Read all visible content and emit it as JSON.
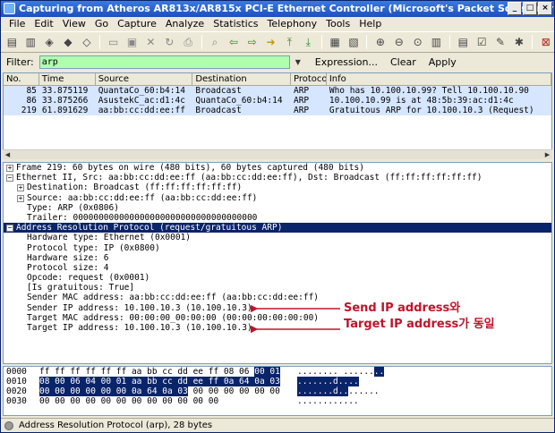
{
  "window": {
    "title": "Capturing from Atheros AR813x/AR815x PCI-E Ethernet Controller (Microsoft's Packet Scheduler)  -  Wireshark"
  },
  "menu": [
    "File",
    "Edit",
    "View",
    "Go",
    "Capture",
    "Analyze",
    "Statistics",
    "Telephony",
    "Tools",
    "Help"
  ],
  "filter": {
    "label": "Filter:",
    "value": "arp",
    "expression_label": "Expression...",
    "clear_label": "Clear",
    "apply_label": "Apply"
  },
  "packet_list": {
    "columns": [
      "No.",
      "Time",
      "Source",
      "Destination",
      "Protocol",
      "Info"
    ],
    "rows": [
      {
        "no": "85",
        "time": "33.875119",
        "source": "QuantaCo_60:b4:14",
        "destination": "Broadcast",
        "protocol": "ARP",
        "info": "Who has 10.100.10.99?  Tell 10.100.10.90"
      },
      {
        "no": "86",
        "time": "33.875266",
        "source": "AsustekC_ac:d1:4c",
        "destination": "QuantaCo_60:b4:14",
        "protocol": "ARP",
        "info": "10.100.10.99 is at 48:5b:39:ac:d1:4c"
      },
      {
        "no": "219",
        "time": "61.891629",
        "source": "aa:bb:cc:dd:ee:ff",
        "destination": "Broadcast",
        "protocol": "ARP",
        "info": "Gratuitous ARP for 10.100.10.3 (Request)"
      }
    ]
  },
  "details": {
    "frame": "Frame 219: 60 bytes on wire (480 bits), 60 bytes captured (480 bits)",
    "ethernet": "Ethernet II, Src: aa:bb:cc:dd:ee:ff (aa:bb:cc:dd:ee:ff), Dst: Broadcast (ff:ff:ff:ff:ff:ff)",
    "eth_dst": "Destination: Broadcast (ff:ff:ff:ff:ff:ff)",
    "eth_src": "Source: aa:bb:cc:dd:ee:ff (aa:bb:cc:dd:ee:ff)",
    "eth_type": "Type: ARP (0x0806)",
    "eth_trailer": "Trailer: 000000000000000000000000000000000000",
    "arp": "Address Resolution Protocol (request/gratuitous ARP)",
    "arp_hw_type": "Hardware type: Ethernet (0x0001)",
    "arp_proto_type": "Protocol type: IP (0x0800)",
    "arp_hw_size": "Hardware size: 6",
    "arp_proto_size": "Protocol size: 4",
    "arp_opcode": "Opcode: request (0x0001)",
    "arp_gratuitous": "[Is gratuitous: True]",
    "arp_sender_mac": "Sender MAC address: aa:bb:cc:dd:ee:ff (aa:bb:cc:dd:ee:ff)",
    "arp_sender_ip": "Sender IP address: 10.100.10.3 (10.100.10.3)",
    "arp_target_mac": "Target MAC address: 00:00:00_00:00:00 (00:00:00:00:00:00)",
    "arp_target_ip": "Target IP address: 10.100.10.3 (10.100.10.3)"
  },
  "annotation": {
    "line1": "Send IP address와",
    "line2": "Target IP address가 동일",
    "color": "#c0132a"
  },
  "bytes": [
    {
      "offset": "0000",
      "hex_a": "ff ff ff ff ff ff aa bb  cc dd ee ff 08 06 ",
      "hex_b": "00 01",
      "ascii_a": "........ ......",
      "ascii_b": ".."
    },
    {
      "offset": "0010",
      "hex_a": "",
      "hex_b": "08 00 06 04 00 01 aa bb  cc dd ee ff 0a 64 0a 03",
      "ascii_a": "",
      "ascii_b": ".......d...."
    },
    {
      "offset": "0020",
      "hex_a": "",
      "hex_b": "00 00 00 00 00 00 0a 64  0a 03",
      "hex_c": " 00 00 00 00 00 00",
      "ascii_a": "",
      "ascii_b": ".......d..",
      "ascii_c": "......"
    },
    {
      "offset": "0030",
      "hex_a": "00 00 00 00 00 00 00 00  00 00 00 00",
      "hex_b": "",
      "ascii_a": "............",
      "ascii_b": ""
    }
  ],
  "status": {
    "text": "Address Resolution Protocol (arp), 28 bytes"
  }
}
